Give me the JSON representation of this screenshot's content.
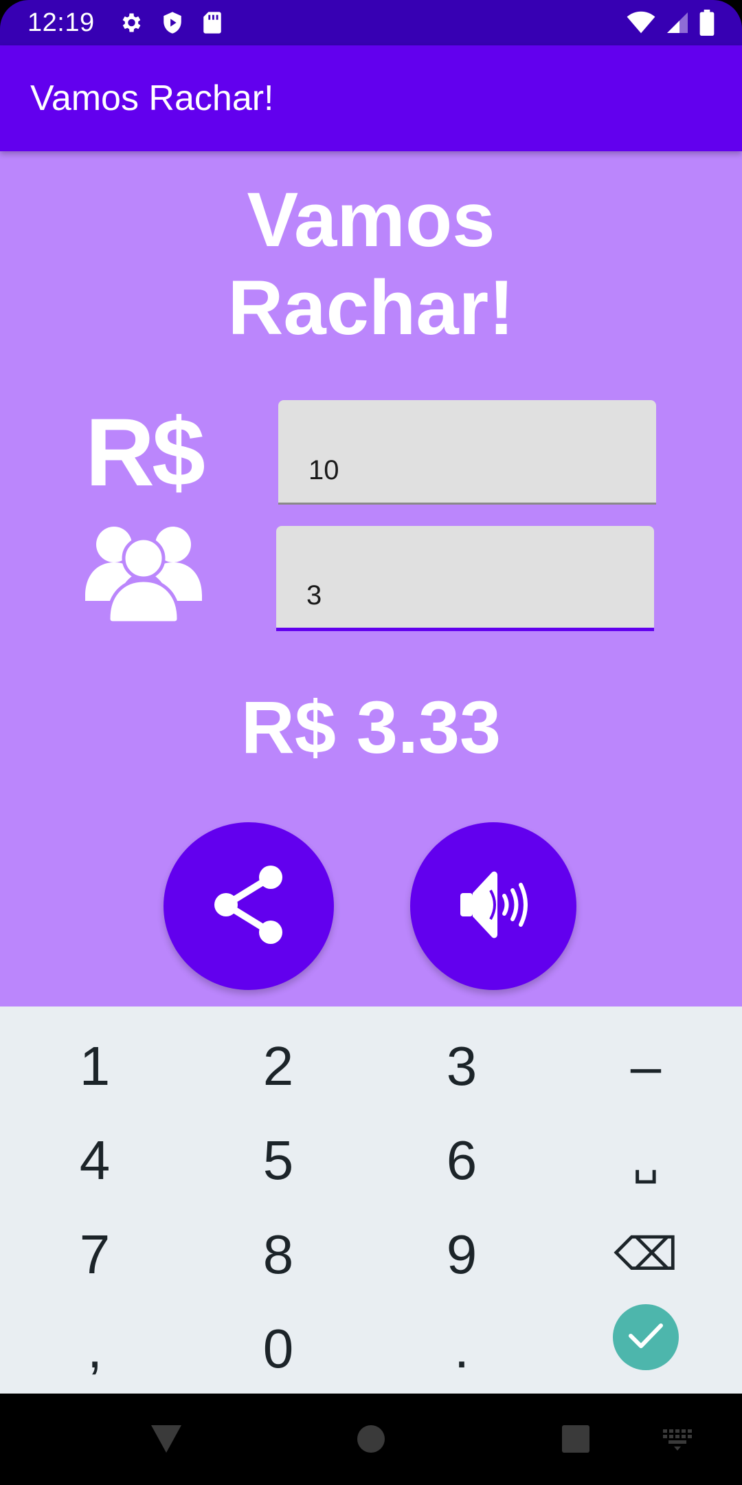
{
  "status_bar": {
    "time": "12:19",
    "left_icons": [
      "gear-icon",
      "shield-play-icon",
      "sd-card-icon"
    ],
    "right_icons": [
      "wifi-icon",
      "signal-icon",
      "battery-icon"
    ]
  },
  "app_bar": {
    "title": "Vamos Rachar!"
  },
  "content": {
    "headline_line1": "Vamos",
    "headline_line2": "Rachar!",
    "currency_label": "R$",
    "amount_value": "10",
    "people_value": "3",
    "result": "R$ 3.33",
    "share_icon": "share-icon",
    "speak_icon": "speaker-icon"
  },
  "keyboard": {
    "keys": [
      "1",
      "2",
      "3",
      "–",
      "4",
      "5",
      "6",
      "␣",
      "7",
      "8",
      "9",
      "⌫",
      ",",
      "0",
      "."
    ],
    "enter_icon": "check-icon"
  },
  "colors": {
    "status_bar": "#3700b3",
    "primary": "#6200ee",
    "background": "#bb86fc",
    "keyboard_bg": "#e9eef2",
    "enter_key": "#4db6ac"
  }
}
